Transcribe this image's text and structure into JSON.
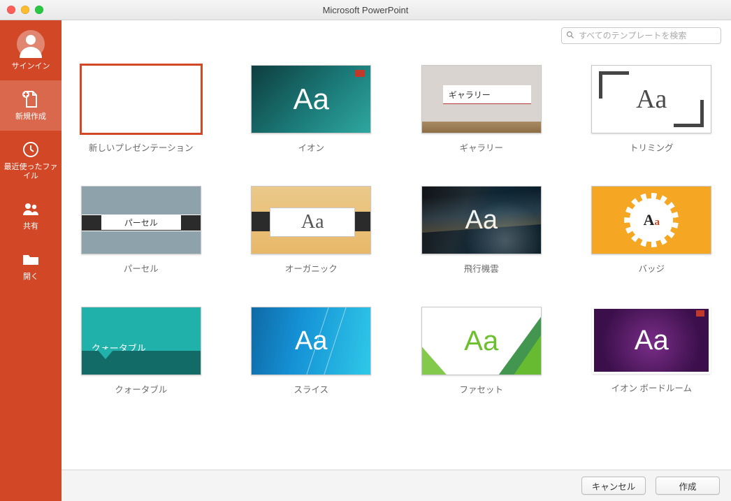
{
  "title": "Microsoft PowerPoint",
  "search": {
    "placeholder": "すべてのテンプレートを検索"
  },
  "sidebar": {
    "signin": {
      "label": "サインイン"
    },
    "new": {
      "label": "新規作成"
    },
    "recent": {
      "label": "最近使ったファイル"
    },
    "shared": {
      "label": "共有"
    },
    "open": {
      "label": "開く"
    }
  },
  "templates": {
    "blank": {
      "label": "新しいプレゼンテーション"
    },
    "ion": {
      "label": "イオン",
      "sample": "Aa"
    },
    "gallery": {
      "label": "ギャラリー",
      "sample": "ギャラリー"
    },
    "trim": {
      "label": "トリミング",
      "sample": "Aa"
    },
    "parcel": {
      "label": "パーセル",
      "sample": "パーセル"
    },
    "organic": {
      "label": "オーガニック",
      "sample": "Aa"
    },
    "vapor": {
      "label": "飛行機雲",
      "sample": "Aa"
    },
    "badge": {
      "label": "バッジ",
      "sample_big": "A",
      "sample_small": "a"
    },
    "quotable": {
      "label": "クォータブル",
      "sample": "クォータブル"
    },
    "slice": {
      "label": "スライス",
      "sample": "Aa"
    },
    "facet": {
      "label": "ファセット",
      "sample": "Aa"
    },
    "ionboard": {
      "label": "イオン ボードルーム",
      "sample": "Aa"
    }
  },
  "footer": {
    "cancel": "キャンセル",
    "create": "作成"
  }
}
